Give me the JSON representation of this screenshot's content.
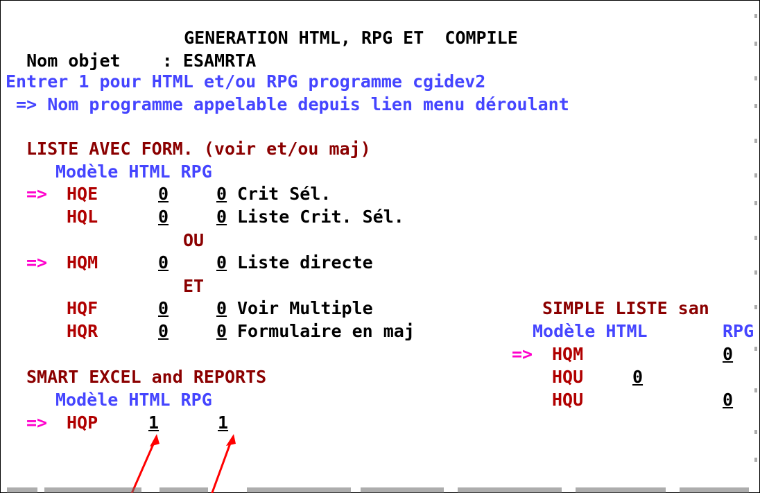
{
  "screen": {
    "title": "GENERATION HTML, RPG ET  COMPILE",
    "object_label": "Nom objet    :",
    "object_value": "ESAMRTA",
    "instr1": "Entrer 1 pour HTML et/ou RPG programme cgidev2",
    "instr2": " => Nom programme appelable depuis lien menu déroulant"
  },
  "liste": {
    "heading": "LISTE AVEC FORM. (voir et/ou maj)",
    "col_header": "Modèle HTML RPG",
    "arrow": "=>",
    "or_label": "OU",
    "and_label": "ET",
    "rows": [
      {
        "arrow": "=>",
        "code": "HQE",
        "html": "0",
        "rpg": "0",
        "desc": "Crit Sél."
      },
      {
        "arrow": "",
        "code": "HQL",
        "html": "0",
        "rpg": "0",
        "desc": "Liste Crit. Sél."
      },
      {
        "arrow": "=>",
        "code": "HQM",
        "html": "0",
        "rpg": "0",
        "desc": "Liste directe"
      },
      {
        "arrow": "",
        "code": "HQF",
        "html": "0",
        "rpg": "0",
        "desc": "Voir Multiple"
      },
      {
        "arrow": "",
        "code": "HQR",
        "html": "0",
        "rpg": "0",
        "desc": "Formulaire en maj"
      }
    ]
  },
  "simple": {
    "heading": "SIMPLE LISTE san",
    "col_header_model": "Modèle HTML",
    "col_header_rpg": "RPG",
    "rows": [
      {
        "arrow": "=>",
        "code": "HQM",
        "html": "",
        "rpg": "0"
      },
      {
        "arrow": "",
        "code": "HQU",
        "html": "0",
        "rpg": ""
      },
      {
        "arrow": "",
        "code": "HQU",
        "html": "",
        "rpg": "0"
      }
    ]
  },
  "excel": {
    "heading": "SMART EXCEL and REPORTS",
    "col_header": "Modèle HTML RPG",
    "row": {
      "arrow": "=>",
      "code": "HQP",
      "html": "1",
      "rpg": "1"
    }
  },
  "colors": {
    "black": "#000000",
    "blue": "#4545ff",
    "red": "#b00000",
    "pink": "#ff00cc",
    "dark_red": "#8b0000",
    "arrow": "#ff0000"
  }
}
